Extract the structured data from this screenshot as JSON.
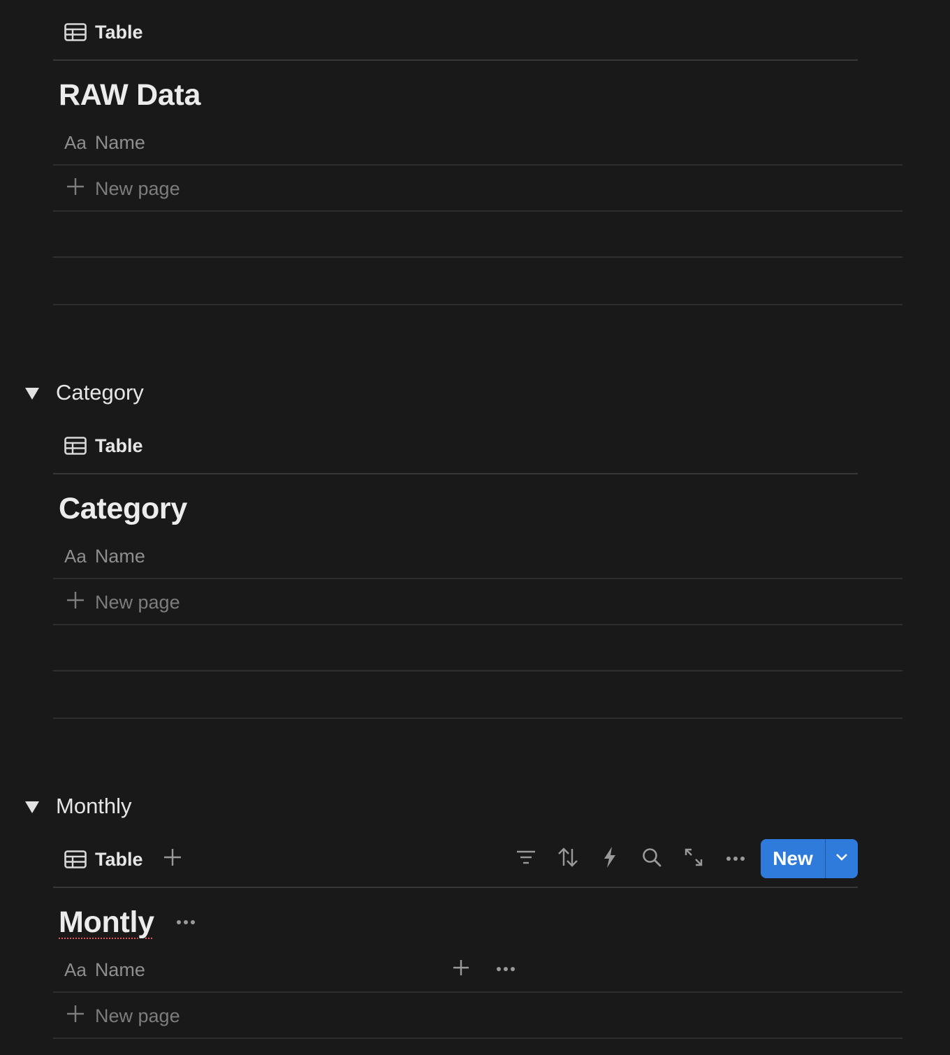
{
  "raw_section": {
    "tab": {
      "icon": "table-icon",
      "label": "Table"
    },
    "title": "RAW Data",
    "name_column": {
      "icon": "Aa",
      "label": "Name"
    },
    "new_page": "New page"
  },
  "category_section": {
    "heading": "Category",
    "tab": {
      "icon": "table-icon",
      "label": "Table"
    },
    "title": "Category",
    "name_column": {
      "icon": "Aa",
      "label": "Name"
    },
    "new_page": "New page"
  },
  "monthly_section": {
    "heading": "Monthly",
    "tab": {
      "icon": "table-icon",
      "label": "Table"
    },
    "toolbar": [
      "filter-icon",
      "sort-icon",
      "automation-icon",
      "search-icon",
      "expand-icon",
      "more-icon"
    ],
    "new_button": "New",
    "title": "Montly",
    "name_column": {
      "icon": "Aa",
      "label": "Name"
    },
    "new_page": "New page"
  },
  "colors": {
    "background": "#191919",
    "accent": "#2f7bdc",
    "spellcheck": "#e05555"
  }
}
